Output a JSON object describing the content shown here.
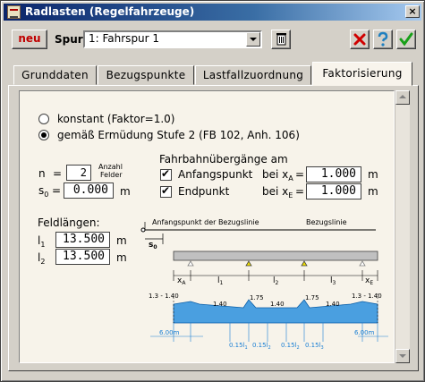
{
  "window": {
    "title": "Radlasten (Regelfahrzeuge)",
    "close_glyph": "×"
  },
  "toolbar": {
    "neu_label": "neu",
    "spur_label": "Spur",
    "spur_value": "1: Fahrspur 1"
  },
  "tabs": [
    {
      "label": "Grunddaten"
    },
    {
      "label": "Bezugspunkte"
    },
    {
      "label": "Lastfallzuordnung"
    },
    {
      "label": "Faktorisierung"
    }
  ],
  "options": {
    "konstant_label": "konstant (Faktor=1.0)",
    "ermuedung_label": "gemäß Ermüdung Stufe 2 (FB 102, Anh. 106)",
    "selected": "ermuedung"
  },
  "n_field": {
    "label": "n",
    "eq": "=",
    "value": "2",
    "anzahl": "Anzahl",
    "felder": "Felder"
  },
  "s0_field": {
    "label": "s",
    "sub": "0",
    "eq": "=",
    "value": "0.000",
    "unit": "m"
  },
  "fahrbahn": {
    "heading": "Fahrbahnübergänge am",
    "anfang_label": "Anfangspunkt",
    "anfang_checked": true,
    "anfang_bei": "bei x",
    "anfang_sub": "A",
    "anfang_value": "1.000",
    "anfang_unit": "m",
    "end_label": "Endpunkt",
    "end_checked": true,
    "end_bei": "bei x",
    "end_sub": "E",
    "end_value": "1.000",
    "end_unit": "m",
    "eq": "="
  },
  "feldlaengen": {
    "heading": "Feldlängen:",
    "rows": [
      {
        "label": "l",
        "sub": "1",
        "value": "13.500",
        "unit": "m"
      },
      {
        "label": "l",
        "sub": "2",
        "value": "13.500",
        "unit": "m"
      }
    ]
  },
  "diagram": {
    "anfang_text": "Anfangspunkt der Bezugslinie",
    "bezug_text": "Bezugslinie",
    "s0": "s",
    "s0_sub": "0",
    "xa": "x",
    "xa_sub": "A",
    "xe": "x",
    "xe_sub": "E",
    "l1": "l",
    "l1_sub": "1",
    "l2": "l",
    "l2_sub": "2",
    "l3": "l",
    "l3_sub": "3",
    "v_left": "1.3 - 1.40",
    "v_right": "1.3 - 1.40",
    "v_140a": "1.40",
    "v_175a": "1.75",
    "v_140b": "1.40",
    "v_175b": "1.75",
    "v_140c": "1.40",
    "d_left": "6.00m",
    "d_right": "6.00m",
    "d_015_1": "0.15l",
    "d_015_1_sub": "1",
    "d_015_2a": "0.15l",
    "d_015_2a_sub": "2",
    "d_015_2b": "0.15l",
    "d_015_2b_sub": "2",
    "d_015_3": "0.15l",
    "d_015_3_sub": "3",
    "fill_color": "#4a9fe0",
    "dim_color": "#1a7fd4"
  }
}
